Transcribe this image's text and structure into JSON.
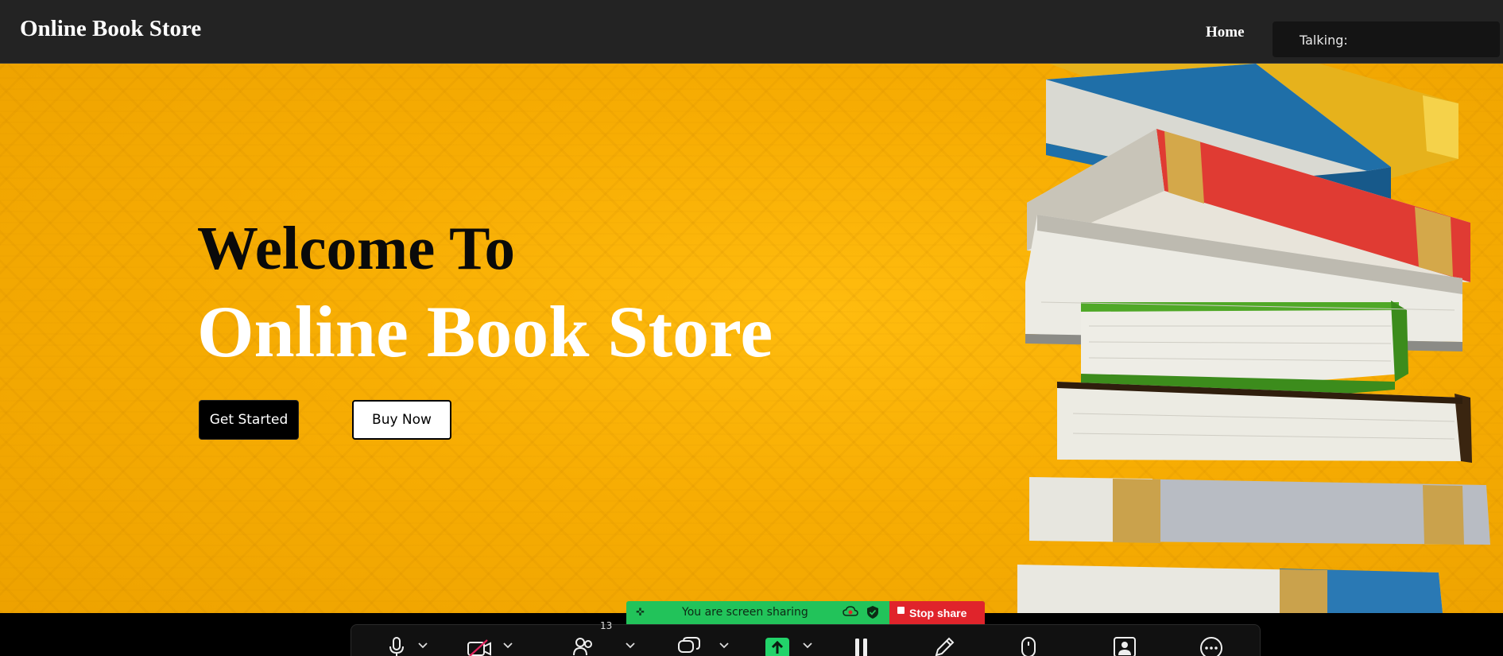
{
  "navbar": {
    "brand": "Online Book Store",
    "home_link": "Home",
    "talking_label": "Talking:"
  },
  "hero": {
    "line1": "Welcome To",
    "line2": "Online Book Store",
    "get_started_label": "Get Started",
    "buy_now_label": "Buy Now"
  },
  "share": {
    "message": "You are screen sharing",
    "stop_label": "Stop share"
  },
  "toolbar": {
    "participants_count": "13",
    "items": [
      "mic-icon",
      "video-off-icon",
      "participants-icon",
      "chat-icon",
      "share-screen-icon",
      "pause-icon",
      "annotate-icon",
      "remote-control-icon",
      "avatar-icon",
      "more-icon"
    ]
  },
  "colors": {
    "navbar_bg": "#232323",
    "hero_bg": "#f7ad03",
    "share_green": "#22c35a",
    "stop_red": "#e0242b"
  }
}
